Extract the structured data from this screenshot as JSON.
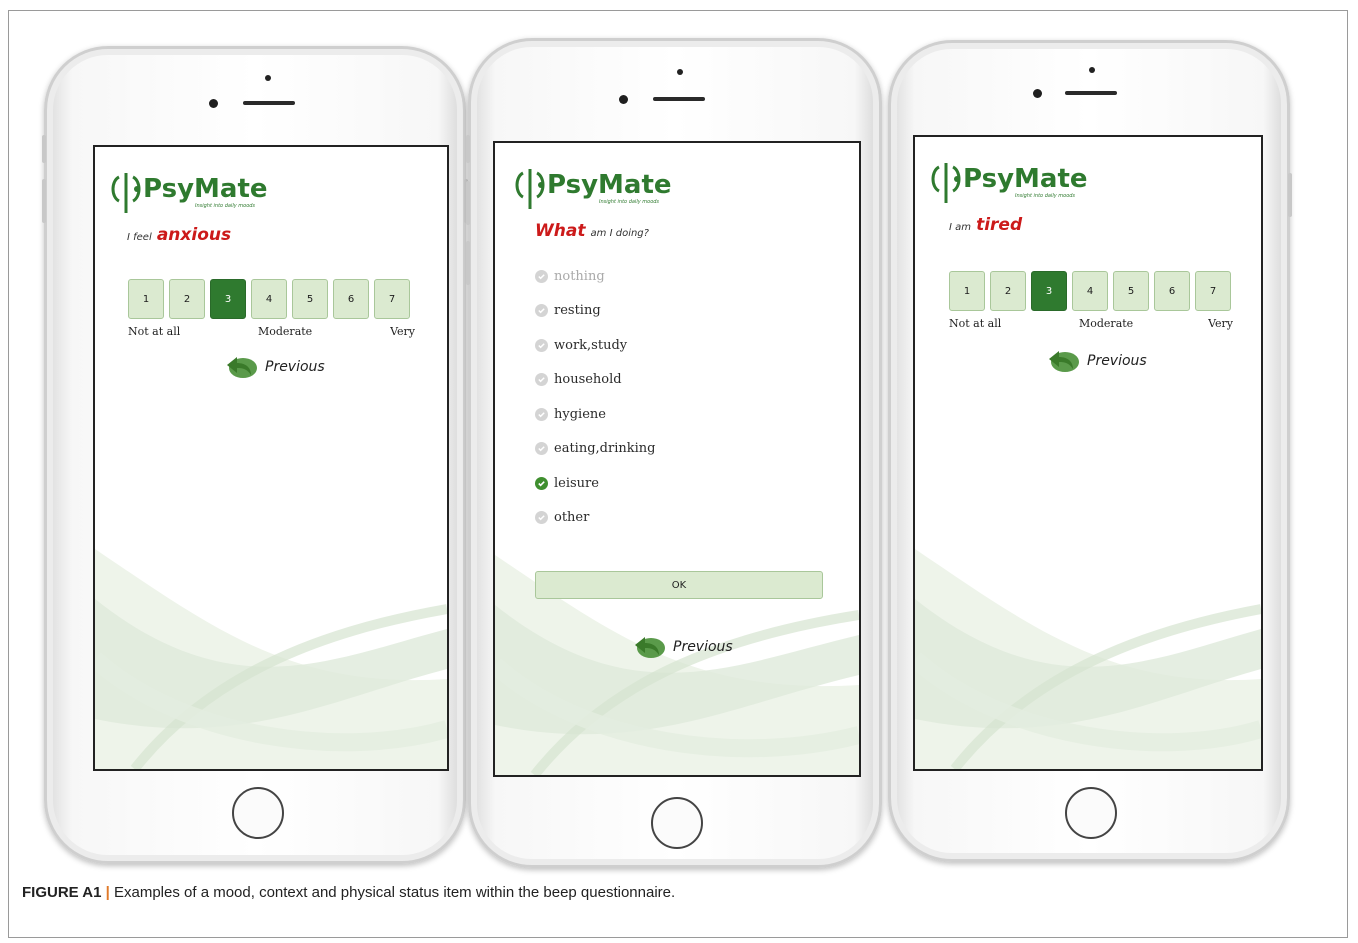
{
  "caption": {
    "label": "FIGURE A1",
    "separator": "|",
    "text": "Examples of a mood, context and physical status item within the beep questionnaire."
  },
  "logo": {
    "brand": "PsyMate",
    "tagline": "Insight into daily moods"
  },
  "phone1": {
    "prompt_small": "I feel",
    "prompt_big": "anxious",
    "scale": [
      "1",
      "2",
      "3",
      "4",
      "5",
      "6",
      "7"
    ],
    "selected_value": "3",
    "label_low": "Not at all",
    "label_mid": "Moderate",
    "label_high": "Very",
    "previous_label": "Previous"
  },
  "phone2": {
    "prompt_big": "What",
    "prompt_small": "am I doing?",
    "options": [
      "nothing",
      "resting",
      "work,study",
      "household",
      "hygiene",
      "eating,drinking",
      "leisure",
      "other"
    ],
    "checked_option": "leisure",
    "ok_label": "OK",
    "previous_label": "Previous"
  },
  "phone3": {
    "prompt_small": "I am",
    "prompt_big": "tired",
    "scale": [
      "1",
      "2",
      "3",
      "4",
      "5",
      "6",
      "7"
    ],
    "selected_value": "3",
    "label_low": "Not at all",
    "label_mid": "Moderate",
    "label_high": "Very",
    "previous_label": "Previous"
  },
  "colors": {
    "accent_green": "#2f7a2f",
    "scale_green": "#dbead0",
    "prompt_red": "#cc1a1a"
  }
}
